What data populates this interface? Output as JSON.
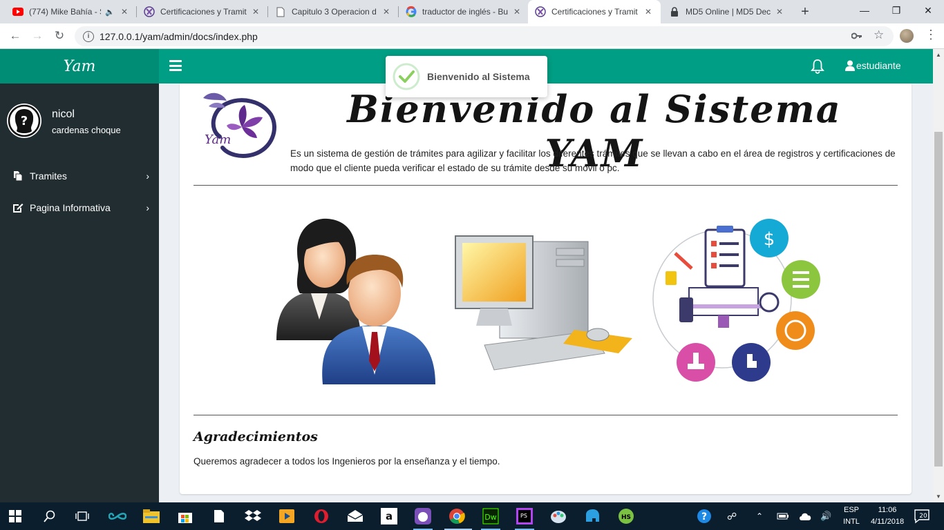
{
  "browser": {
    "tabs": [
      {
        "title": "(774) Mike Bahía - S",
        "icon": "youtube-icon",
        "audio": true
      },
      {
        "title": "Certificaciones y Tramit",
        "icon": "yam-favicon"
      },
      {
        "title": "Capitulo 3 Operacion d",
        "icon": "document-icon"
      },
      {
        "title": "traductor de inglés - Bu",
        "icon": "google-icon"
      },
      {
        "title": "Certificaciones y Tramit",
        "icon": "yam-favicon",
        "active": true
      },
      {
        "title": "MD5 Online | MD5 Dec",
        "icon": "lock-icon"
      }
    ],
    "url": "127.0.0.1/yam/admin/docs/index.php"
  },
  "app": {
    "brand": "Yam",
    "user_menu": "estudiante",
    "toast": "Bienvenido al Sistema"
  },
  "sidebar": {
    "user_name": "nicol",
    "user_subtitle": "cardenas choque",
    "items": [
      {
        "label": "Tramites",
        "icon": "files-icon"
      },
      {
        "label": "Pagina Informativa",
        "icon": "edit-icon"
      }
    ]
  },
  "main": {
    "logo_text": "Yam",
    "title": "Bienvenido al Sistema YAM",
    "description": "Es un sistema de gestión de trámites para agilizar y facilitar los diferentes trámites que se llevan a cabo en el área de registros y certificaciones de modo que el cliente pueda verificar el estado de su trámite desde su móvil o pc.",
    "thanks_title": "Agradecimientos",
    "thanks_text": "Queremos agradecer a todos los Ingenieros por la enseñanza y el tiempo."
  },
  "taskbar": {
    "lang": "ESP",
    "layout": "INTL",
    "time": "11:06",
    "date": "4/11/2018",
    "notifications": "20"
  },
  "colors": {
    "brand_dark": "#008d76",
    "brand": "#009e84",
    "sidebar": "#222d32"
  }
}
